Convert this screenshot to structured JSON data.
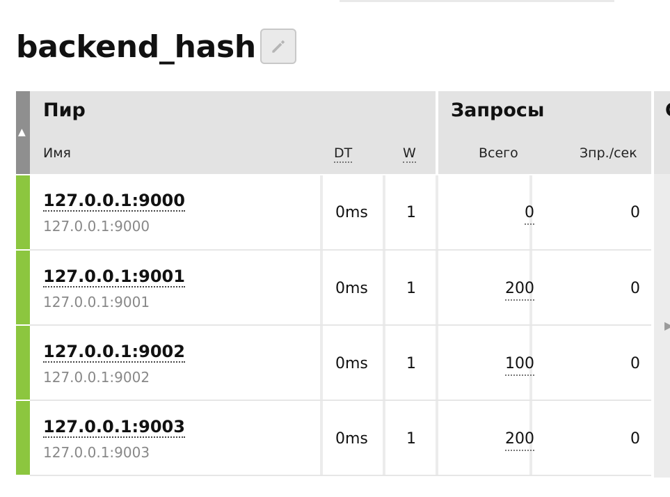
{
  "page": {
    "title": "backend_hash"
  },
  "icons": {
    "edit": "pencil-icon",
    "sort": "sort-up-arrow-icon",
    "scroll_right": "chevron-right-icon"
  },
  "colors": {
    "status_up": "#8cc63f",
    "header_bg": "#e3e3e3"
  },
  "table": {
    "groups": {
      "peer": "Пир",
      "requests": "Запросы"
    },
    "columns": {
      "name": "Имя",
      "dt": "DT",
      "w": "W",
      "total": "Всего",
      "rps": "Зпр./сек"
    },
    "rows": [
      {
        "name": "127.0.0.1:9000",
        "address": "127.0.0.1:9000",
        "dt": "0ms",
        "w": "1",
        "total": "0",
        "rps": "0"
      },
      {
        "name": "127.0.0.1:9001",
        "address": "127.0.0.1:9001",
        "dt": "0ms",
        "w": "1",
        "total": "200",
        "rps": "0"
      },
      {
        "name": "127.0.0.1:9002",
        "address": "127.0.0.1:9002",
        "dt": "0ms",
        "w": "1",
        "total": "100",
        "rps": "0"
      },
      {
        "name": "127.0.0.1:9003",
        "address": "127.0.0.1:9003",
        "dt": "0ms",
        "w": "1",
        "total": "200",
        "rps": "0"
      }
    ]
  }
}
